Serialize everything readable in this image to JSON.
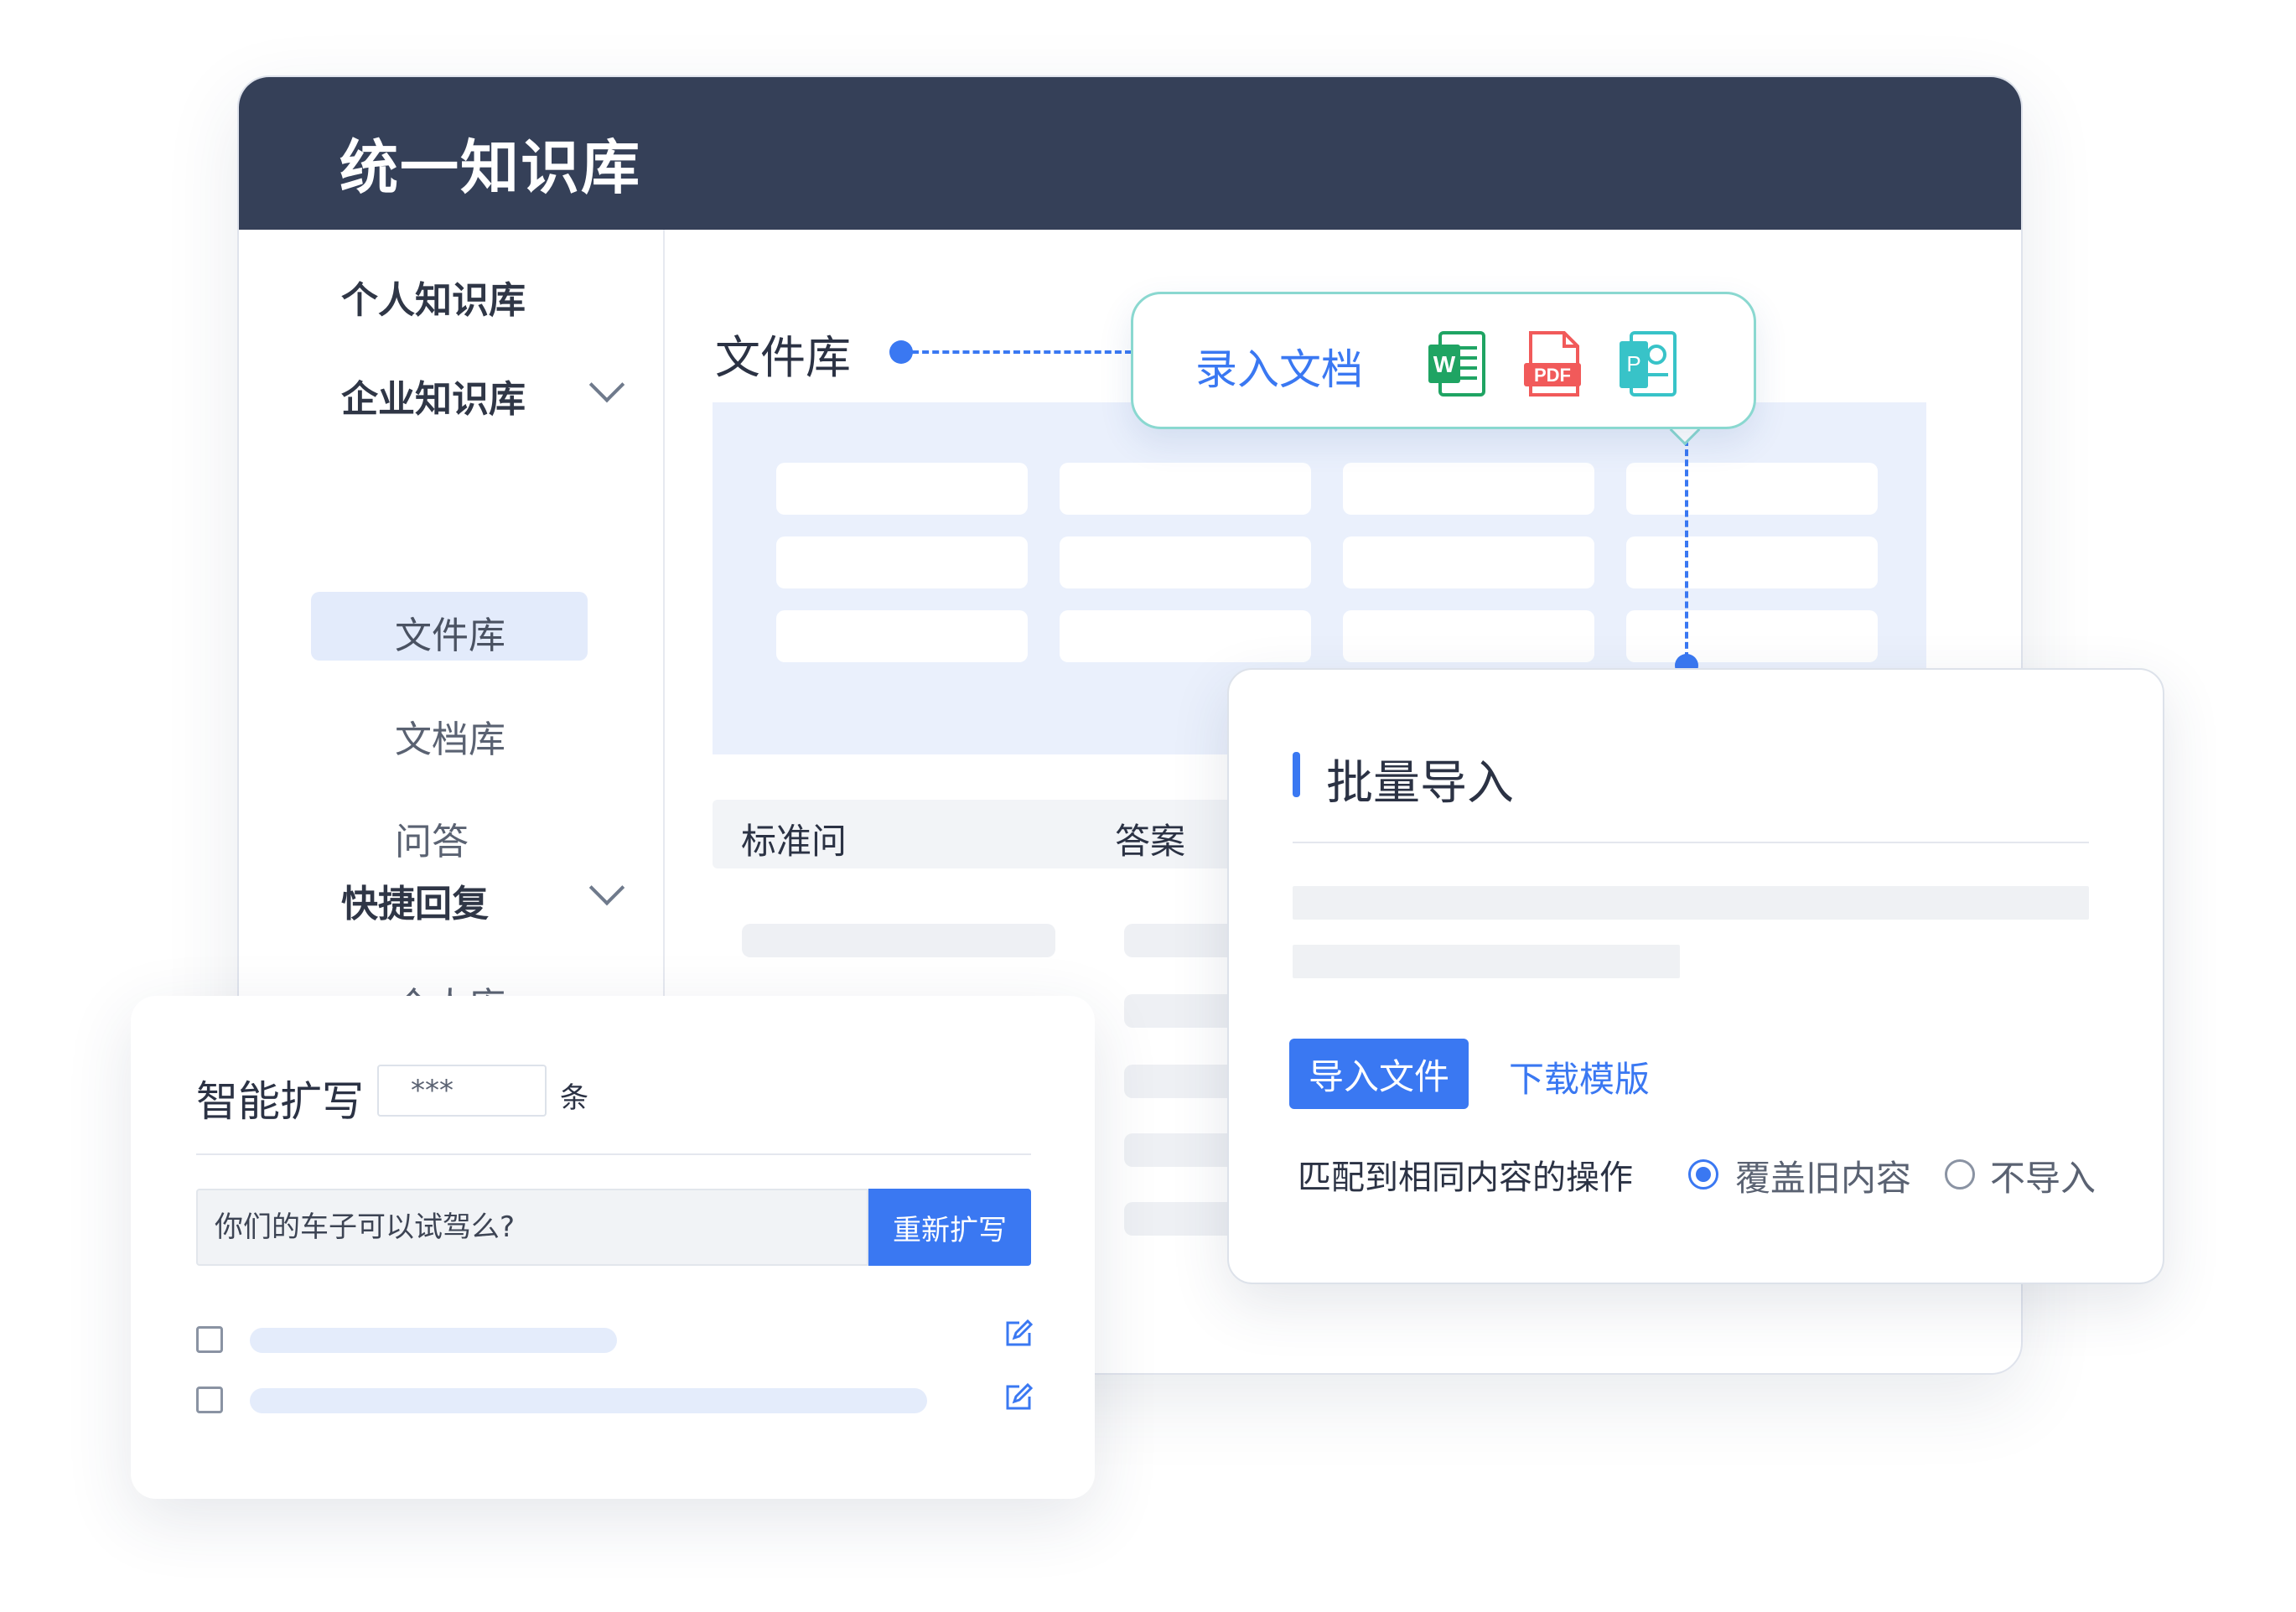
{
  "app": {
    "title": "统一知识库"
  },
  "sidebar": {
    "personal_kb": "个人知识库",
    "enterprise_kb": "企业知识库",
    "file_lib": "文件库",
    "doc_lib": "文档库",
    "qa": "问答",
    "quick_reply": "快捷回复",
    "personal_lib": "个人库"
  },
  "content": {
    "title": "文件库",
    "qa_header": {
      "question": "标准问",
      "answer": "答案"
    }
  },
  "tooltip": {
    "label": "录入文档",
    "icons": [
      "word-icon",
      "pdf-icon",
      "ppt-icon"
    ],
    "word_letter": "W",
    "pdf_text": "PDF",
    "ppt_letter": "P"
  },
  "batch_import": {
    "title": "批量导入",
    "import_button": "导入文件",
    "download_link": "下载模版",
    "match_label": "匹配到相同内容的操作",
    "options": [
      {
        "label": "覆盖旧内容",
        "checked": true
      },
      {
        "label": "不导入",
        "checked": false
      }
    ]
  },
  "smart_expand": {
    "title": "智能扩写",
    "count_value": "***",
    "unit": "条",
    "query": "你们的车子可以试驾么?",
    "rewrite_button": "重新扩写"
  },
  "colors": {
    "header_bg": "#354058",
    "accent": "#3a78f2",
    "tooltip_border": "#8ad8d0",
    "word": "#1fa463",
    "pdf": "#f15a5a",
    "ppt": "#38c3c8"
  }
}
